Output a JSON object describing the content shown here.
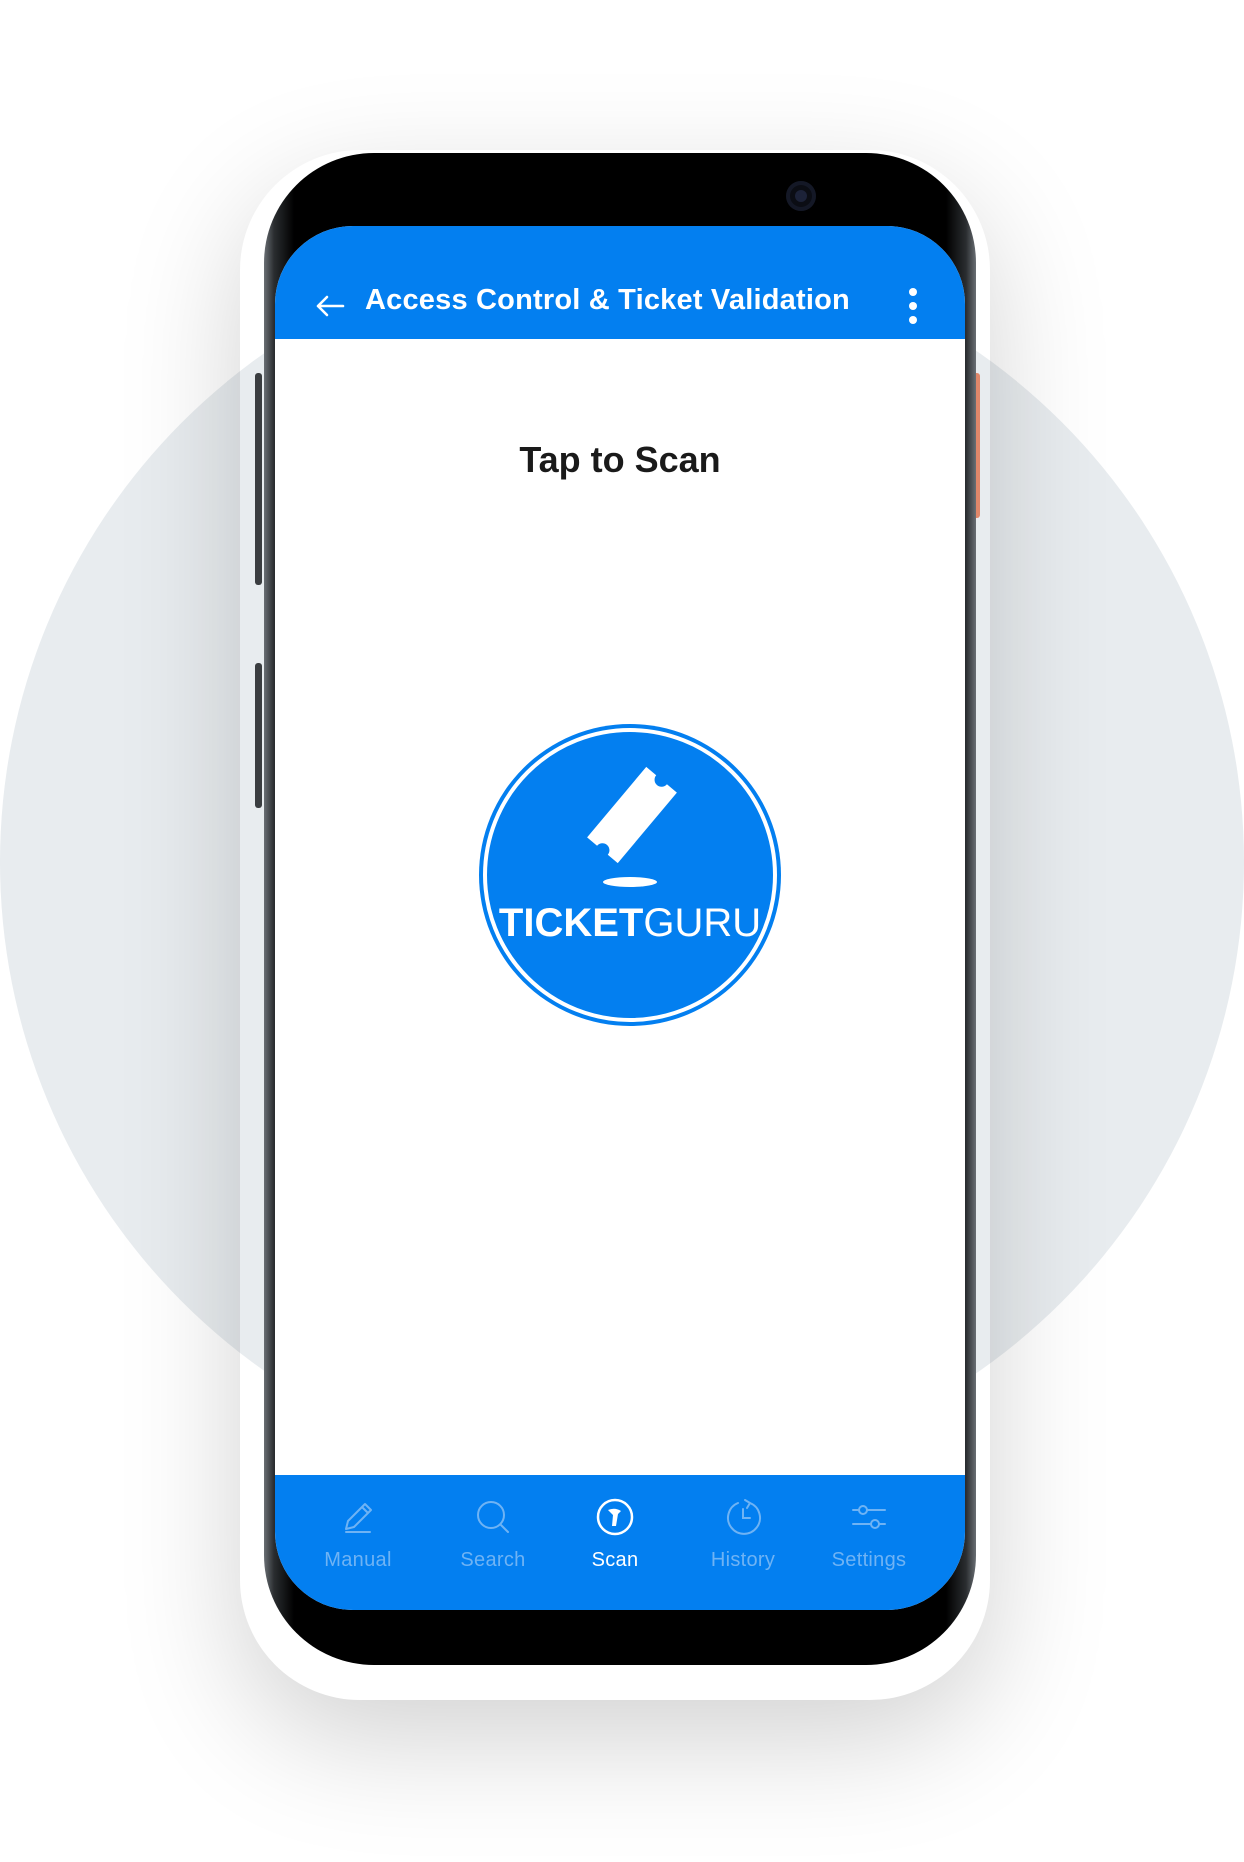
{
  "app_bar": {
    "title": "Access Control & Ticket Validation",
    "back_icon": "back-arrow-icon",
    "menu_icon": "more-vertical-icon"
  },
  "main": {
    "heading": "Tap to Scan",
    "logo": {
      "text_bold": "TICKET",
      "text_light": "GURU",
      "icon": "ticket-icon"
    }
  },
  "bottom_nav": {
    "items": [
      {
        "label": "Manual",
        "icon": "pencil-icon",
        "active": false
      },
      {
        "label": "Search",
        "icon": "search-icon",
        "active": false
      },
      {
        "label": "Scan",
        "icon": "scanner-icon",
        "active": true
      },
      {
        "label": "History",
        "icon": "history-icon",
        "active": false
      },
      {
        "label": "Settings",
        "icon": "sliders-icon",
        "active": false
      }
    ]
  },
  "colors": {
    "primary": "#037ff0",
    "nav_inactive": "#6fb3f4",
    "nav_active": "#ffffff",
    "heading_text": "#1a1a1a",
    "background_circle": "#e8ecef",
    "phone_body": "#000000"
  }
}
